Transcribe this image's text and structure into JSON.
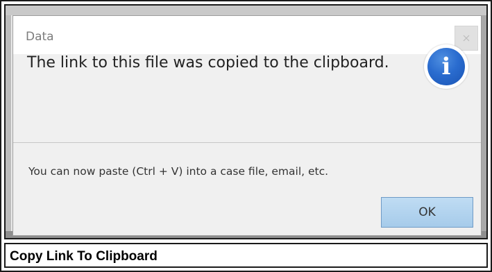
{
  "dialog": {
    "title": "Data",
    "close_icon": "close-icon",
    "message": "The link to this file was copied to the clipboard.",
    "info_icon": "info-icon",
    "info_glyph": "i",
    "detail": "You can now paste (Ctrl + V) into a case file, email, etc.",
    "ok_label": "OK"
  },
  "caption": "Copy Link To Clipboard",
  "colors": {
    "ok_button": "#b3d4ee",
    "info_icon": "#2a6ccf"
  }
}
